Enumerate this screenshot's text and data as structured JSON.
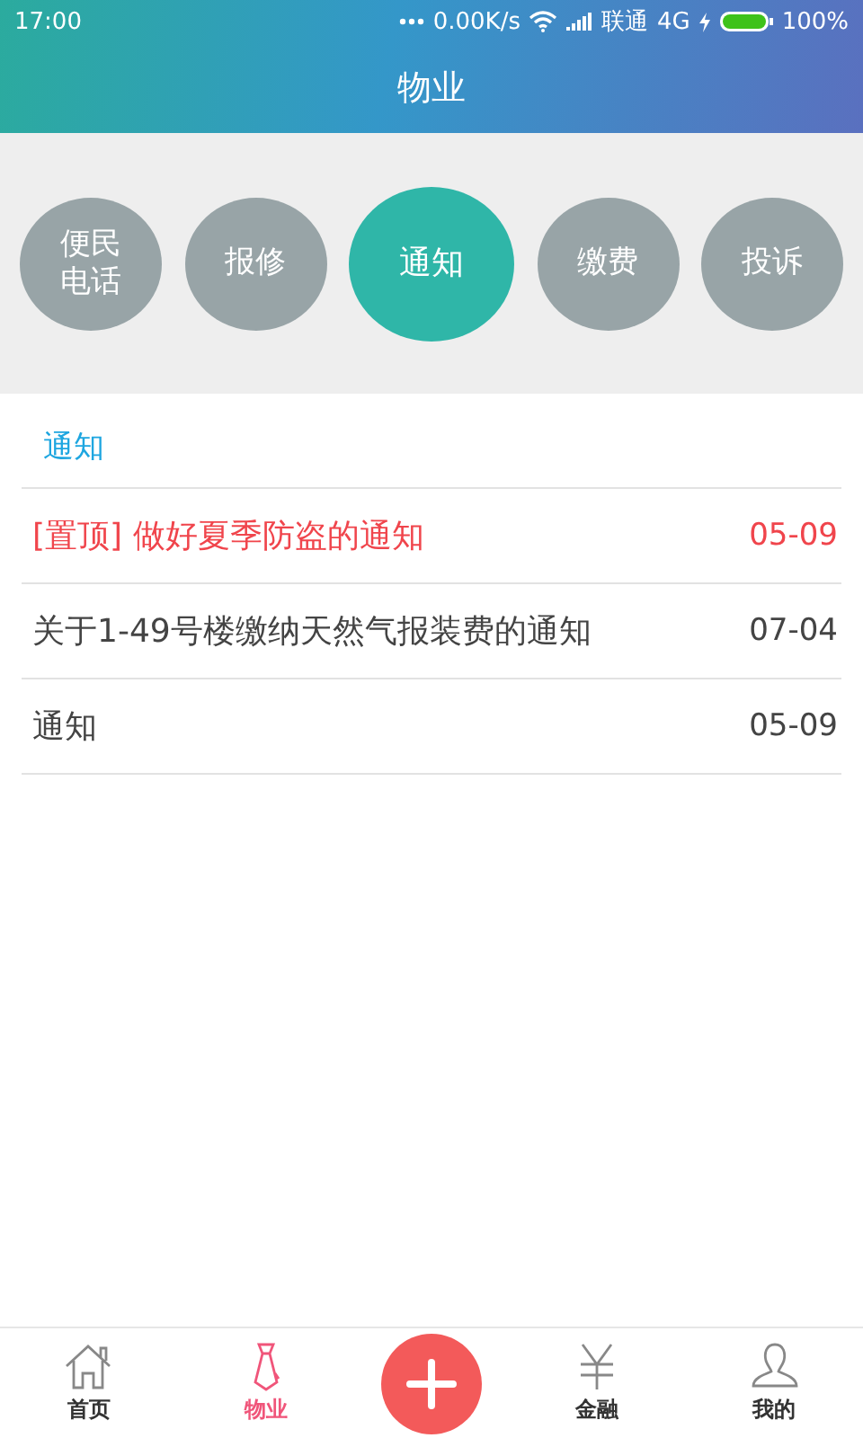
{
  "status_bar": {
    "time": "17:00",
    "speed": "0.00K/s",
    "carrier": "联通",
    "network": "4G",
    "battery": "100%"
  },
  "header": {
    "title": "物业"
  },
  "categories": [
    {
      "label": "便民电话",
      "selected": false
    },
    {
      "label": "报修",
      "selected": false
    },
    {
      "label": "通知",
      "selected": true
    },
    {
      "label": "缴费",
      "selected": false
    },
    {
      "label": "投诉",
      "selected": false
    }
  ],
  "section_title": "通知",
  "notices": [
    {
      "title": "[置顶] 做好夏季防盗的通知",
      "date": "05-09",
      "pinned": true
    },
    {
      "title": "关于1-49号楼缴纳天然气报装费的通知",
      "date": "07-04",
      "pinned": false
    },
    {
      "title": "通知",
      "date": "05-09",
      "pinned": false
    }
  ],
  "bottom_nav": [
    {
      "kind": "home",
      "label": "首页",
      "selected": false
    },
    {
      "kind": "tie",
      "label": "物业",
      "selected": true
    },
    {
      "kind": "add"
    },
    {
      "kind": "yen",
      "label": "金融",
      "selected": false
    },
    {
      "kind": "person",
      "label": "我的",
      "selected": false
    }
  ]
}
